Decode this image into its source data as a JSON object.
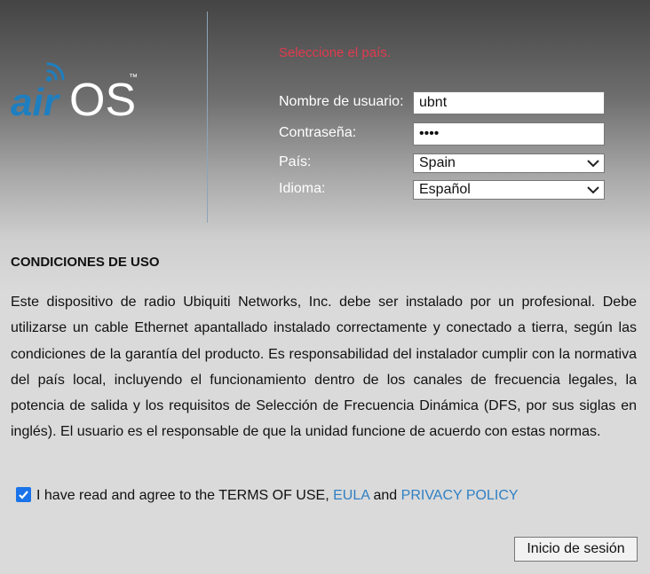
{
  "logo": {
    "text_air": "air",
    "text_os": "OS",
    "trademark": "™"
  },
  "login": {
    "error_message": "Seleccione el país.",
    "username_label": "Nombre de usuario:",
    "username_value": "ubnt",
    "password_label": "Contraseña:",
    "password_value": "••••",
    "country_label": "País:",
    "country_value": "Spain",
    "language_label": "Idioma:",
    "language_value": "Español",
    "submit_label": "Inicio de sesión"
  },
  "terms": {
    "title": "CONDICIONES DE USO",
    "body": "Este dispositivo de radio Ubiquiti Networks, Inc. debe ser instalado por un profesional. Debe utilizarse un cable Ethernet apantallado instalado correctamente y conectado a tierra, según las condiciones de la garantía del producto. Es responsabilidad del instalador cumplir con la normativa del país local, incluyendo el funcionamiento dentro de los canales de frecuencia legales, la potencia de salida y los requisitos de Selección de Frecuencia Dinámica (DFS, por sus siglas en inglés). El usuario es el responsable de que la unidad funcione de acuerdo con estas normas.",
    "agree_text": "I have read and agree to the TERMS OF USE,",
    "eula_link": "EULA",
    "and_text": "and",
    "privacy_link": "PRIVACY POLICY",
    "agree_checked": true
  },
  "colors": {
    "error": "#e23b4e",
    "link": "#2f80c4",
    "logo_blue": "#1e7fc0",
    "checkbox": "#1a73e8"
  }
}
